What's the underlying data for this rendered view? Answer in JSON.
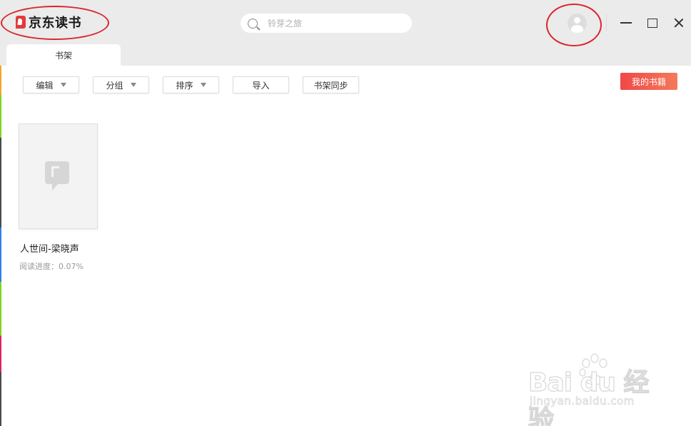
{
  "app": {
    "logo_text": "京东读书"
  },
  "search": {
    "placeholder": "铃芽之旅",
    "icon": "search-icon"
  },
  "user": {
    "icon": "avatar-icon"
  },
  "window_controls": {
    "minimize_icon": "minimize-icon",
    "maximize_icon": "maximize-icon",
    "close_icon": "close-icon"
  },
  "tabs": [
    {
      "label": "书架",
      "active": true
    }
  ],
  "toolbar": {
    "edit_label": "编辑",
    "group_label": "分组",
    "sort_label": "排序",
    "import_label": "导入",
    "sync_label": "书架同步",
    "my_books_label": "我的书籍"
  },
  "books": [
    {
      "title": "人世间-梁晓声",
      "progress": "阅读进度：0.07%"
    }
  ],
  "watermark": {
    "brand": "Bai du 经验",
    "url": "jingyan.baidu.com"
  },
  "colors": {
    "brand_red": "#e4393c",
    "annotation_red": "#d9262d",
    "my_books_gradient_start": "#f04848",
    "my_books_gradient_end": "#f47a5a"
  }
}
